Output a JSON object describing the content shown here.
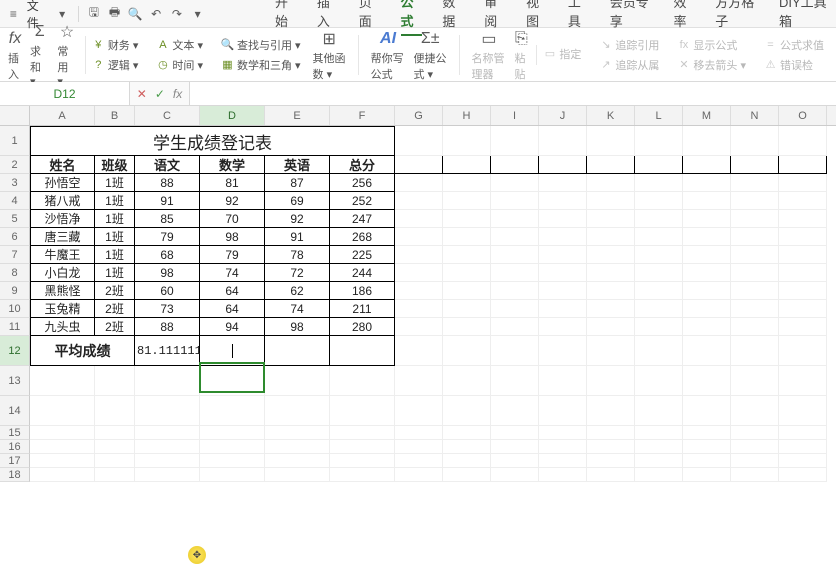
{
  "menu": {
    "file": "文件",
    "tabs": [
      "开始",
      "插入",
      "页面",
      "公式",
      "数据",
      "审阅",
      "视图",
      "工具",
      "会员专享",
      "效率",
      "方方格子",
      "DIY工具箱"
    ],
    "active_index": 3
  },
  "ribbon": {
    "g1": {
      "icon": "fx",
      "label": "插入"
    },
    "g2": {
      "icon": "Σ",
      "label": "求和 ▾"
    },
    "g3": {
      "icon": "☆",
      "label": "常用 ▾"
    },
    "col1": {
      "a": "财务 ▾",
      "b": "逻辑 ▾"
    },
    "col2": {
      "a": "文本 ▾",
      "b": "时间 ▾"
    },
    "col3": {
      "a": "查找与引用 ▾",
      "b": "数学和三角 ▾"
    },
    "g4": {
      "icon": "⊞",
      "label": "其他函数 ▾"
    },
    "g5": {
      "icon": "AI",
      "label": "帮你写公式"
    },
    "g6": {
      "icon": "Σ±",
      "label": "便捷公式 ▾"
    },
    "g7": {
      "icon": "▭",
      "label": "名称管理器"
    },
    "g8": {
      "icon": "⎘",
      "label": "粘贴"
    },
    "g9a": "指定",
    "g9b": "追踪引用",
    "g9c": "追踪从属",
    "g9d": "显示公式",
    "g9e": "移去箭头 ▾",
    "g9f": "公式求值",
    "g9g": "错误检"
  },
  "fbar": {
    "name": "D12",
    "fx": "fx",
    "value": ""
  },
  "cols": [
    "A",
    "B",
    "C",
    "D",
    "E",
    "F",
    "G",
    "H",
    "I",
    "J",
    "K",
    "L",
    "M",
    "N",
    "O"
  ],
  "sheet": {
    "title": "学生成绩登记表",
    "headers": [
      "姓名",
      "班级",
      "语文",
      "数学",
      "英语",
      "总分"
    ],
    "rows": [
      [
        "孙悟空",
        "1班",
        "88",
        "81",
        "87",
        "256"
      ],
      [
        "猪八戒",
        "1班",
        "91",
        "92",
        "69",
        "252"
      ],
      [
        "沙悟净",
        "1班",
        "85",
        "70",
        "92",
        "247"
      ],
      [
        "唐三藏",
        "1班",
        "79",
        "98",
        "91",
        "268"
      ],
      [
        "牛魔王",
        "1班",
        "68",
        "79",
        "78",
        "225"
      ],
      [
        "小白龙",
        "1班",
        "98",
        "74",
        "72",
        "244"
      ],
      [
        "黑熊怪",
        "2班",
        "60",
        "64",
        "62",
        "186"
      ],
      [
        "玉兔精",
        "2班",
        "73",
        "64",
        "74",
        "211"
      ],
      [
        "九头虫",
        "2班",
        "88",
        "94",
        "98",
        "280"
      ]
    ],
    "avg_label": "平均成绩",
    "avg_c": "81.111111"
  },
  "chart_data": {
    "type": "table",
    "title": "学生成绩登记表",
    "columns": [
      "姓名",
      "班级",
      "语文",
      "数学",
      "英语",
      "总分"
    ],
    "rows": [
      [
        "孙悟空",
        "1班",
        88,
        81,
        87,
        256
      ],
      [
        "猪八戒",
        "1班",
        91,
        92,
        69,
        252
      ],
      [
        "沙悟净",
        "1班",
        85,
        70,
        92,
        247
      ],
      [
        "唐三藏",
        "1班",
        79,
        98,
        91,
        268
      ],
      [
        "牛魔王",
        "1班",
        68,
        79,
        78,
        225
      ],
      [
        "小白龙",
        "1班",
        98,
        74,
        72,
        244
      ],
      [
        "黑熊怪",
        "2班",
        60,
        64,
        62,
        186
      ],
      [
        "玉兔精",
        "2班",
        73,
        64,
        74,
        211
      ],
      [
        "九头虫",
        "2班",
        88,
        94,
        98,
        280
      ]
    ],
    "summary": {
      "平均成绩": {
        "语文": 81.111111
      }
    }
  }
}
